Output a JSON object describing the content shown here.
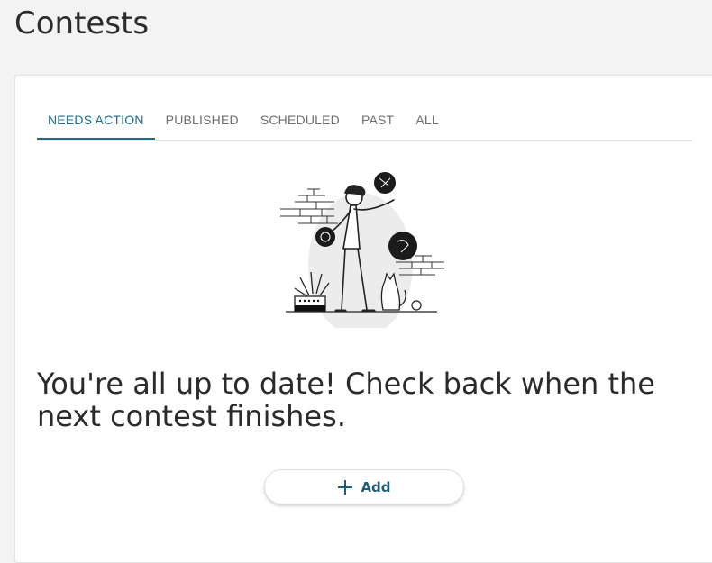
{
  "page": {
    "title": "Contests"
  },
  "tabs": [
    {
      "label": "NEEDS ACTION",
      "active": true
    },
    {
      "label": "PUBLISHED",
      "active": false
    },
    {
      "label": "SCHEDULED",
      "active": false
    },
    {
      "label": "PAST",
      "active": false
    },
    {
      "label": "ALL",
      "active": false
    }
  ],
  "empty_state": {
    "illustration": "person-juggling-illustration",
    "message": "You're all up to date! Check back when the next contest finishes.",
    "add_button": {
      "label": "Add",
      "icon": "plus-icon"
    }
  },
  "colors": {
    "accent": "#1d6d87",
    "tab_inactive": "#6d6d6d",
    "page_background": "#f3f3f3",
    "card_background": "#ffffff"
  }
}
